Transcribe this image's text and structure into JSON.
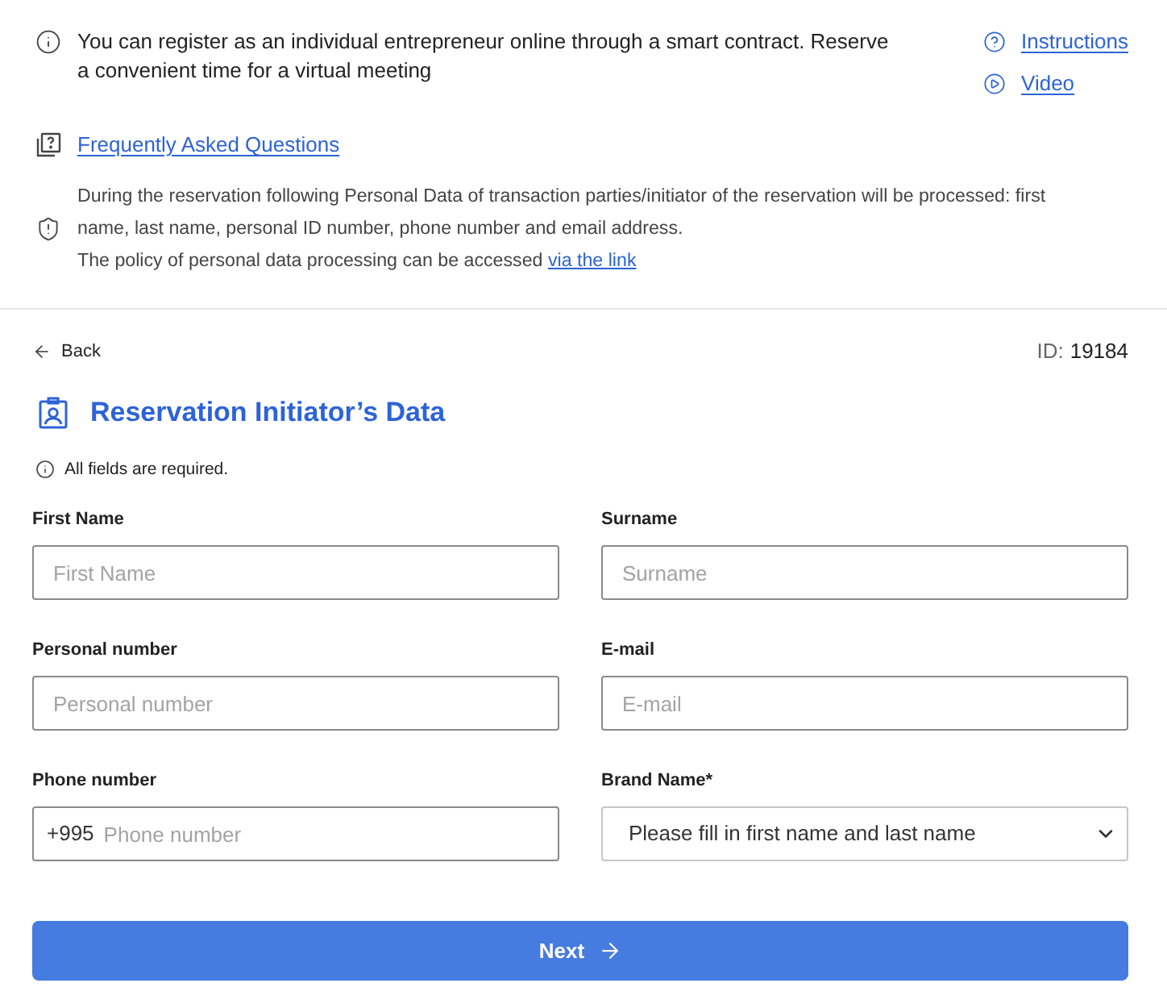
{
  "notice": {
    "text": "You can register as an individual entrepreneur online through a smart contract. Reserve a convenient time for a virtual meeting",
    "links": [
      {
        "kind": "help",
        "label": "Instructions"
      },
      {
        "kind": "video",
        "label": "Video"
      }
    ]
  },
  "faq_link": "Frequently Asked Questions",
  "privacy": {
    "text": "During the reservation following Personal Data of transaction parties/initiator of the reservation will be processed: first name, last name, personal ID number, phone number and email address.",
    "policy_text": "The policy of personal data processing can be accessed",
    "policy_link": "via the link"
  },
  "back": "Back",
  "record_id": {
    "label": "ID:",
    "value": "19184"
  },
  "section_title": "Reservation Initiator’s Data",
  "required_note": "All fields are required.",
  "fields": [
    {
      "kind": "text",
      "label": "First Name",
      "placeholder": "First Name"
    },
    {
      "kind": "text",
      "label": "Surname",
      "placeholder": "Surname"
    },
    {
      "kind": "text",
      "label": "Personal number",
      "placeholder": "Personal number"
    },
    {
      "kind": "text",
      "label": "E-mail",
      "placeholder": "E-mail"
    },
    {
      "kind": "phone",
      "label": "Phone number",
      "prefix": "+995",
      "placeholder": "Phone number"
    },
    {
      "kind": "select",
      "label": "Brand Name*",
      "value": "Please fill in first name and last name"
    }
  ],
  "next_button": "Next"
}
